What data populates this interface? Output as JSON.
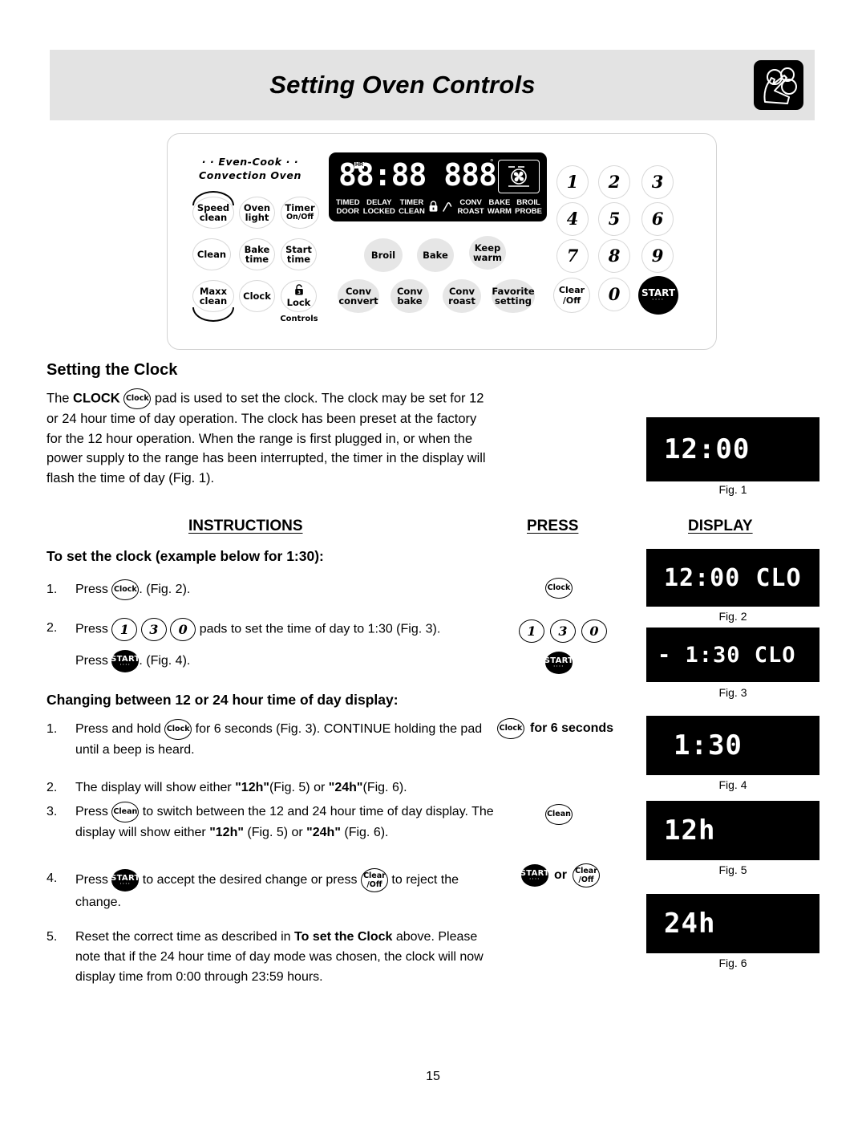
{
  "header": {
    "title": "Setting Oven Controls",
    "icon": "hand-pressing-buttons-icon"
  },
  "control_panel": {
    "brand_line1": "· · Even-Cook · ·",
    "brand_line2": "Convection Oven",
    "left_pads": [
      {
        "line1": "Speed",
        "line2": "clean",
        "arc": "top"
      },
      {
        "line1": "Oven",
        "line2": "light"
      },
      {
        "line1": "Timer",
        "line2": "On/Off"
      },
      {
        "line1": "Clean",
        "line2": ""
      },
      {
        "line1": "Bake",
        "line2": "time"
      },
      {
        "line1": "Start",
        "line2": "time"
      },
      {
        "line1": "Maxx",
        "line2": "clean",
        "arc": "bottom"
      },
      {
        "line1": "Clock",
        "line2": ""
      },
      {
        "line1": "Lock",
        "line2": "",
        "icon": "padlock-3-icon"
      }
    ],
    "lock_caption": "Controls",
    "function_pads": [
      {
        "line1": "Broil",
        "line2": ""
      },
      {
        "line1": "Bake",
        "line2": ""
      },
      {
        "line1": "Keep",
        "line2": "warm"
      },
      {
        "line1": "Conv",
        "line2": "convert"
      },
      {
        "line1": "Conv",
        "line2": "bake"
      },
      {
        "line1": "Conv",
        "line2": "roast"
      },
      {
        "line1": "Favorite",
        "line2": "setting"
      }
    ],
    "keypad": [
      "1",
      "2",
      "3",
      "4",
      "5",
      "6",
      "7",
      "8",
      "9"
    ],
    "clear_line1": "Clear",
    "clear_line2": "/Off",
    "zero": "0",
    "start": "START",
    "display": {
      "segments": "88:88 888",
      "hr_tag": "HR",
      "degree": "°",
      "fan_icon": "convection-fan-icon",
      "indicators": [
        {
          "top": "TIMED",
          "bottom": "DOOR"
        },
        {
          "top": "DELAY",
          "bottom": "LOCKED"
        },
        {
          "top": "TIMER",
          "bottom": "CLEAN"
        },
        {
          "top": "lock-icon",
          "bottom": ""
        },
        {
          "top": "probe-icon",
          "bottom": ""
        },
        {
          "top": "CONV",
          "bottom": "ROAST"
        },
        {
          "top": "BAKE",
          "bottom": "WARM"
        },
        {
          "top": "BROIL",
          "bottom": "PROBE"
        }
      ]
    }
  },
  "setting_clock": {
    "heading": "Setting the Clock",
    "p_a": "The ",
    "p_b": "CLOCK",
    "p_c": " pad is used to set the clock. The clock may be",
    "p_rest": "set for 12 or 24 hour time of day operation.  The clock has been preset at the factory for the 12 hour operation.  When the range is first plugged in, or when the power supply to the range has been interrupted, the timer in the display will flash the time of day (Fig. 1)."
  },
  "columns": {
    "instructions": "INSTRUCTIONS",
    "press": "PRESS",
    "display": "DISPLAY"
  },
  "set_clock_section": {
    "heading": "To set the clock (example below for 1:30):",
    "step1_num": "1.",
    "step1_a": "Press ",
    "step1_b": ". (Fig. 2).",
    "step2_num": "2.",
    "step2_a": "Press ",
    "step2_b": " pads to set the time of day to 1:30 (Fig. 3).",
    "step2_c": "Press ",
    "step2_d": ". (Fig. 4).",
    "pads": [
      "1",
      "3",
      "0"
    ],
    "clock_label": "Clock",
    "start_label": "START"
  },
  "change_section": {
    "heading": "Changing between 12 or 24 hour time of day display:",
    "steps": [
      {
        "num": "1.",
        "a": "Press and hold ",
        "b": " for 6 seconds (Fig. 3). CONTINUE holding the pad until a beep is heard."
      },
      {
        "num": "2.",
        "a": "The display will show either ",
        "bold1": "\"12h\"",
        "mid": "(Fig. 5) or ",
        "bold2": "\"24h\"",
        "end": "(Fig. 6)."
      },
      {
        "num": "3.",
        "a": "Press ",
        "b": " to switch between the 12 and 24 hour time of day display. The display will show either ",
        "bold1": "\"12h\"",
        "mid": " (Fig. 5) or ",
        "bold2": "\"24h\"",
        "end": " (Fig. 6)."
      },
      {
        "num": "4.",
        "a": "Press ",
        "b": " to accept the desired change or press ",
        "c": " to reject the change."
      },
      {
        "num": "5.",
        "a": "Reset the correct time as described in ",
        "bold1": "To set the Clock",
        "b": " above. Please note that if the 24 hour time of day mode was chosen, the clock will now display time from 0:00 through 23:59 hours."
      }
    ]
  },
  "press_column": {
    "clock_label": "Clock",
    "digits": [
      "1",
      "3",
      "0"
    ],
    "start_label": "START",
    "hold_note": "for 6 seconds",
    "clean_label": "Clean",
    "or_label": "or",
    "clear_line1": "Clear",
    "clear_line2": "/Off"
  },
  "figures": [
    {
      "text": "12:00",
      "caption": "Fig. 1"
    },
    {
      "text": "12:00 CLO",
      "caption": "Fig. 2"
    },
    {
      "text": "- 1:30 CLO",
      "caption": "Fig. 3"
    },
    {
      "text": "1:30",
      "caption": "Fig. 4"
    },
    {
      "text": "12h",
      "caption": "Fig. 5"
    },
    {
      "text": "24h",
      "caption": "Fig. 6"
    }
  ],
  "page_number": "15"
}
